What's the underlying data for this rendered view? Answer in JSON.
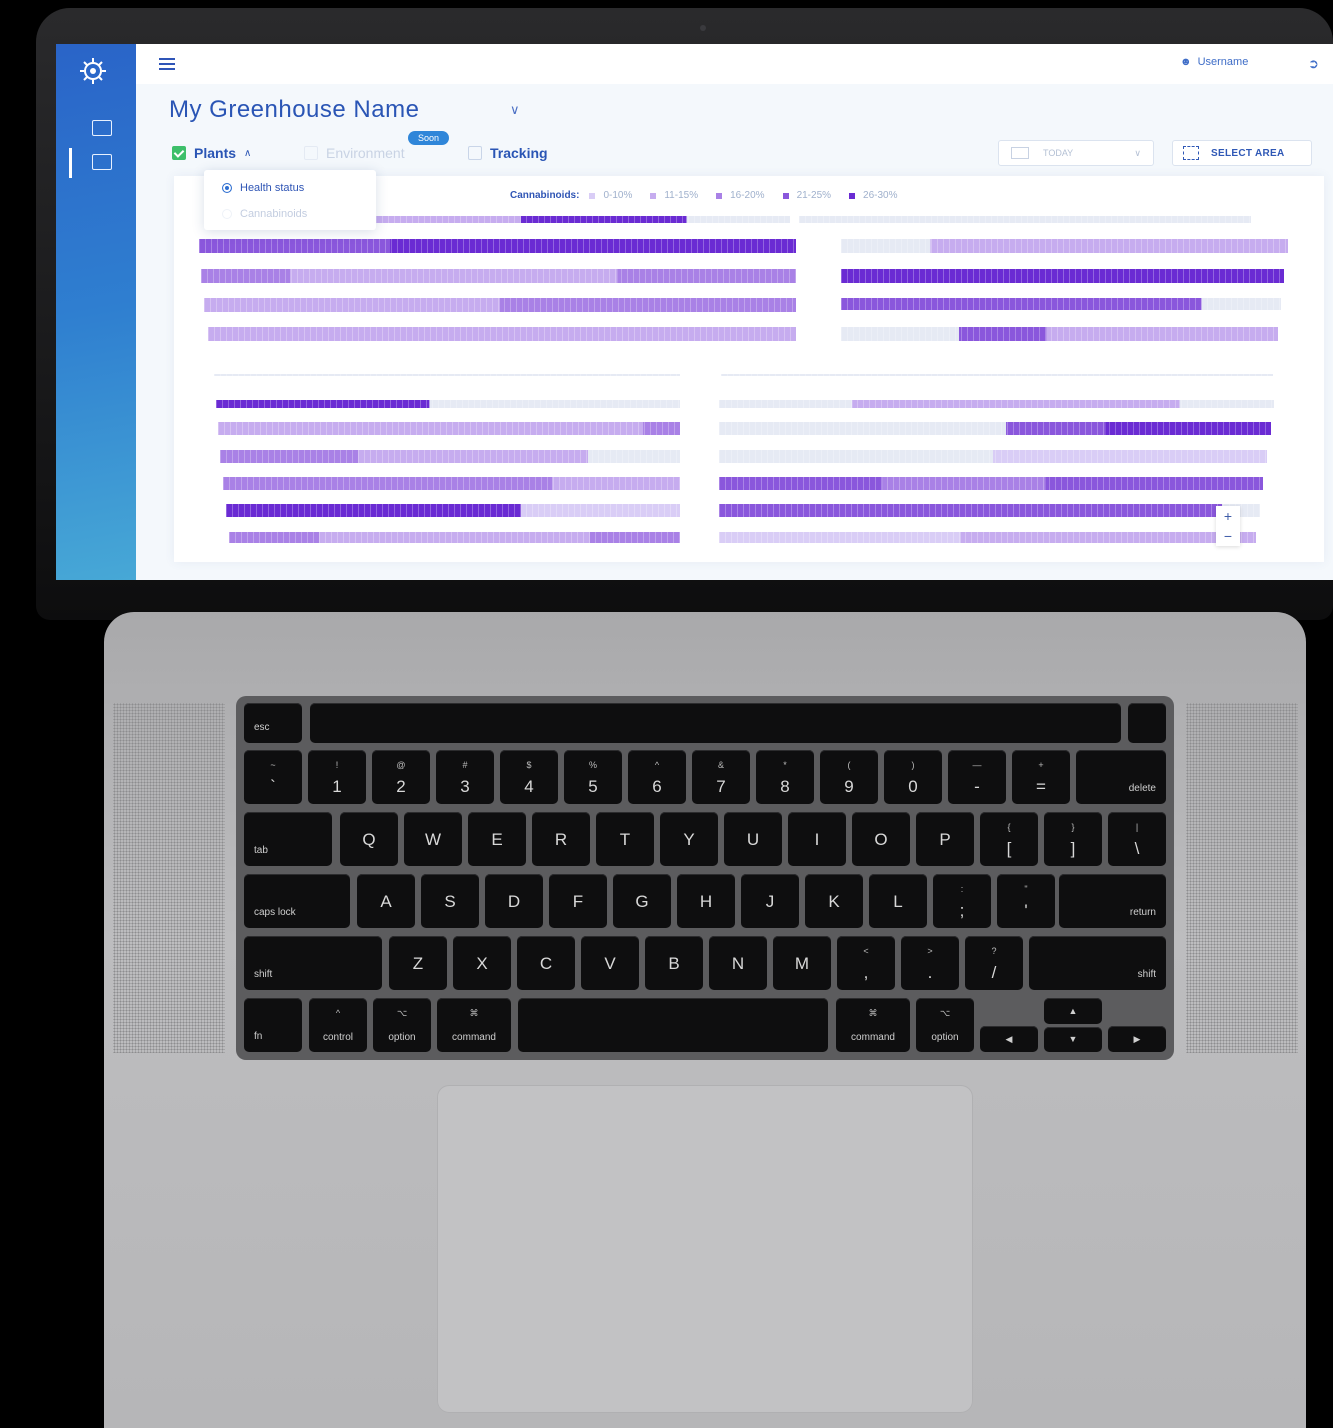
{
  "app": {
    "title": "My Greenhouse Name",
    "username": "Username",
    "tabs": [
      {
        "label": "Plants",
        "checked": true
      },
      {
        "label": "Environment",
        "checked": false,
        "disabled": true,
        "badge": "Soon"
      },
      {
        "label": "Tracking",
        "checked": false
      }
    ],
    "date_label": "TODAY",
    "select_area_label": "SELECT AREA",
    "dropdown_options": [
      {
        "label": "Health status",
        "selected": true
      },
      {
        "label": "Cannabinoids",
        "selected": false
      }
    ],
    "legend_title": "Cannabinoids:",
    "legend": [
      {
        "label": "0-10%",
        "color": "#d9cdf6"
      },
      {
        "label": "11-15%",
        "color": "#c6acef"
      },
      {
        "label": "16-20%",
        "color": "#a981e6"
      },
      {
        "label": "21-25%",
        "color": "#8a57dc"
      },
      {
        "label": "26-30%",
        "color": "#6a2bd3"
      }
    ],
    "zoom_in": "+",
    "zoom_out": "−"
  },
  "keyboard": {
    "esc": "esc",
    "number_row": [
      {
        "top": "~",
        "bottom": "`"
      },
      {
        "top": "!",
        "bottom": "1"
      },
      {
        "top": "@",
        "bottom": "2"
      },
      {
        "top": "#",
        "bottom": "3"
      },
      {
        "top": "$",
        "bottom": "4"
      },
      {
        "top": "%",
        "bottom": "5"
      },
      {
        "top": "^",
        "bottom": "6"
      },
      {
        "top": "&",
        "bottom": "7"
      },
      {
        "top": "*",
        "bottom": "8"
      },
      {
        "top": "(",
        "bottom": "9"
      },
      {
        "top": ")",
        "bottom": "0"
      },
      {
        "top": "—",
        "bottom": "-"
      },
      {
        "top": "+",
        "bottom": "="
      }
    ],
    "delete": "delete",
    "tab": "tab",
    "row_q": [
      "Q",
      "W",
      "E",
      "R",
      "T",
      "Y",
      "U",
      "I",
      "O",
      "P"
    ],
    "row_q_sym": [
      {
        "top": "{",
        "bottom": "["
      },
      {
        "top": "}",
        "bottom": "]"
      },
      {
        "top": "|",
        "bottom": "\\"
      }
    ],
    "caps": "caps lock",
    "caps_dot": "•",
    "row_a": [
      "A",
      "S",
      "D",
      "F",
      "G",
      "H",
      "J",
      "K",
      "L"
    ],
    "row_a_sym": [
      {
        "top": ":",
        "bottom": ";"
      },
      {
        "top": "\"",
        "bottom": "'"
      }
    ],
    "return": "return",
    "shift": "shift",
    "row_z": [
      "Z",
      "X",
      "C",
      "V",
      "B",
      "N",
      "M"
    ],
    "row_z_sym": [
      {
        "top": "<",
        "bottom": ","
      },
      {
        "top": ">",
        "bottom": "."
      },
      {
        "top": "?",
        "bottom": "/"
      }
    ],
    "fn": "fn",
    "control": "control",
    "control_sym": "^",
    "option": "option",
    "option_sym": "⌥",
    "command": "command",
    "command_sym": "⌘",
    "arrow_up": "▲",
    "arrow_down": "▼",
    "arrow_left": "◀",
    "arrow_right": "▶"
  }
}
